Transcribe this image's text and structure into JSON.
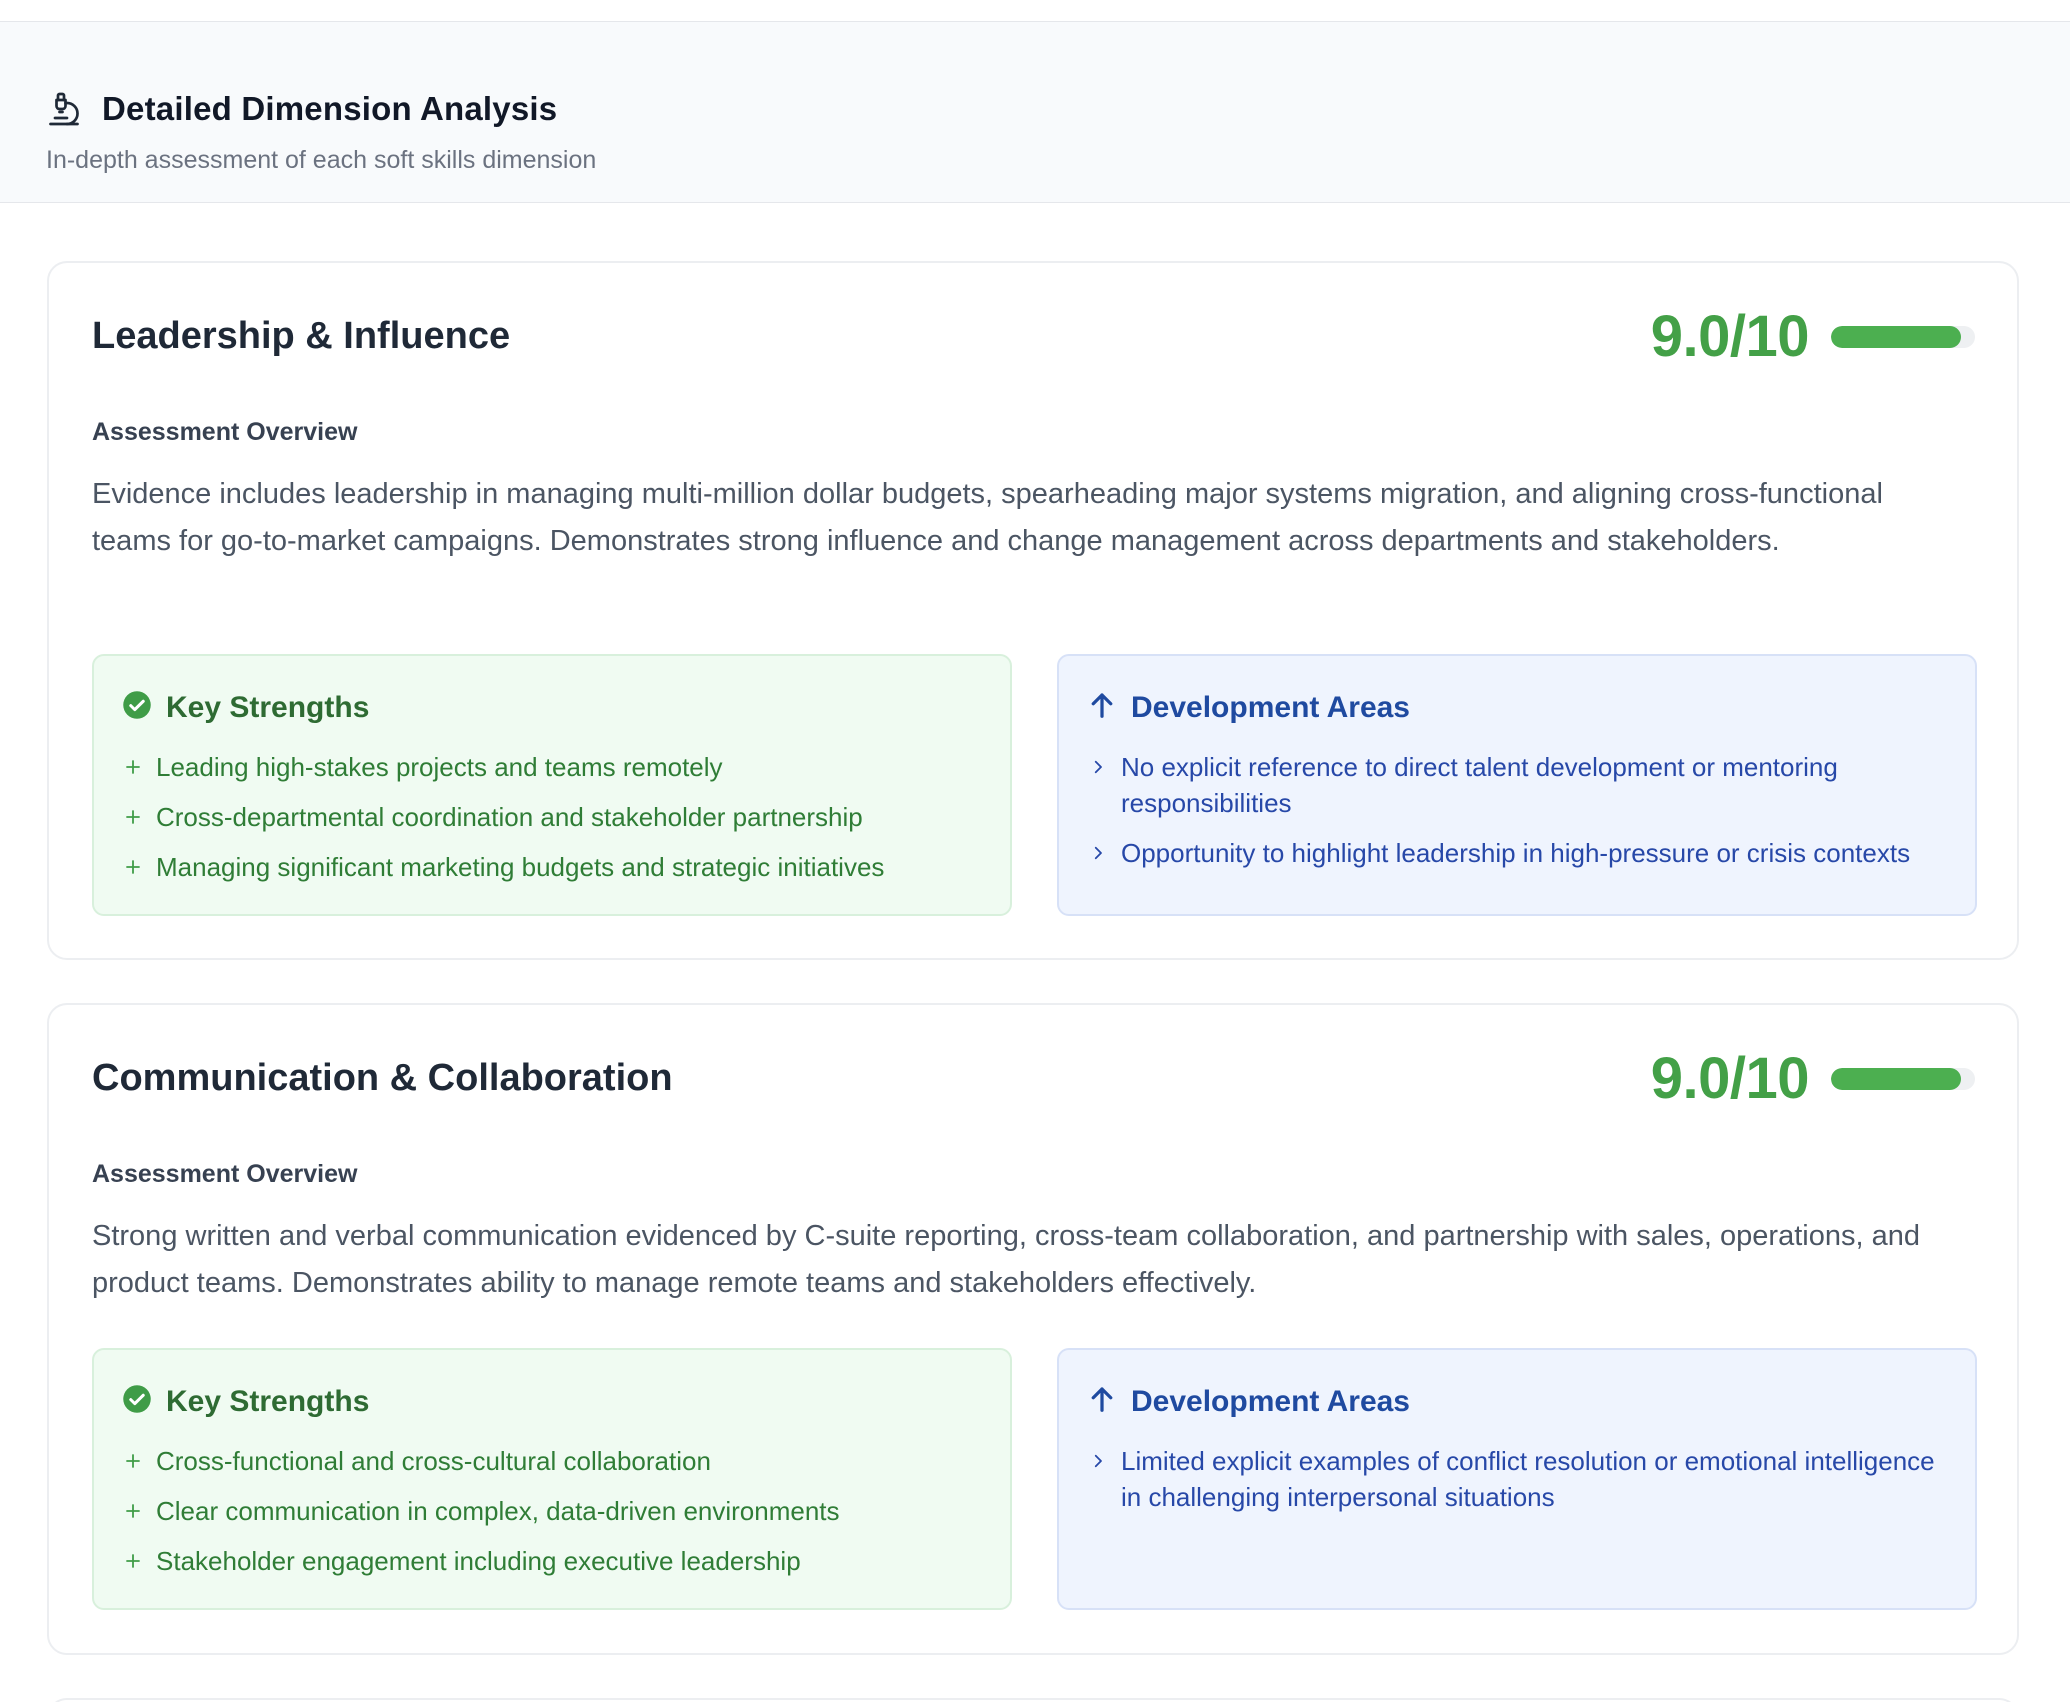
{
  "header": {
    "title": "Detailed Dimension Analysis",
    "subtitle": "In-depth assessment of each soft skills dimension",
    "icon": "microscope-icon"
  },
  "dimensions": [
    {
      "title": "Leadership & Influence",
      "score_label": "9.0/10",
      "score_fraction": 0.9,
      "overview_label": "Assessment Overview",
      "overview": "Evidence includes leadership in managing multi-million dollar budgets, spearheading major systems migration, and aligning cross-functional teams for go-to-market campaigns. Demonstrates strong influence and change management across departments and stakeholders.",
      "strengths_title": "Key Strengths",
      "strengths": [
        "Leading high-stakes projects and teams remotely",
        "Cross-departmental coordination and stakeholder partnership",
        "Managing significant marketing budgets and strategic initiatives"
      ],
      "development_title": "Development Areas",
      "development": [
        "No explicit reference to direct talent development or mentoring responsibilities",
        "Opportunity to highlight leadership in high-pressure or crisis contexts"
      ]
    },
    {
      "title": "Communication & Collaboration",
      "score_label": "9.0/10",
      "score_fraction": 0.9,
      "overview_label": "Assessment Overview",
      "overview": "Strong written and verbal communication evidenced by C-suite reporting, cross-team collaboration, and partnership with sales, operations, and product teams. Demonstrates ability to manage remote teams and stakeholders effectively.",
      "strengths_title": "Key Strengths",
      "strengths": [
        "Cross-functional and cross-cultural collaboration",
        "Clear communication in complex, data-driven environments",
        "Stakeholder engagement including executive leadership"
      ],
      "development_title": "Development Areas",
      "development": [
        "Limited explicit examples of conflict resolution or emotional intelligence in challenging interpersonal situations"
      ]
    }
  ],
  "colors": {
    "score": "#43a047",
    "strengths_text": "#2f7d36",
    "development_text": "#2748a8",
    "strengths_bg": "#f0fbf2",
    "development_bg": "#eff4fe"
  }
}
